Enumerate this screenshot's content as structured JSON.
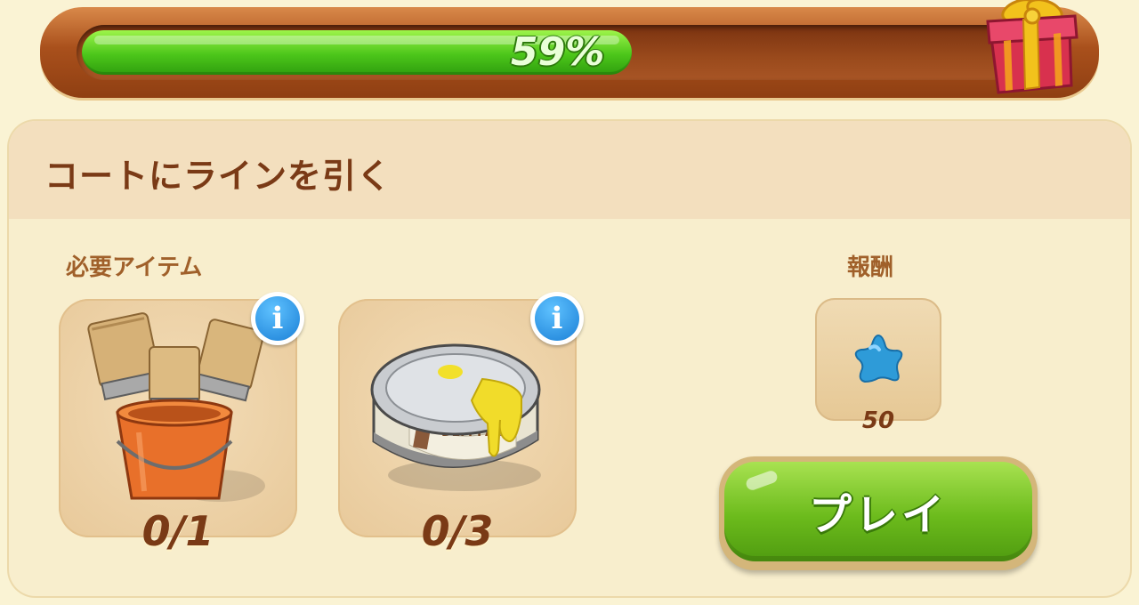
{
  "progress": {
    "percent": 59,
    "label": "59%"
  },
  "task": {
    "title": "コートにラインを引く"
  },
  "required": {
    "label": "必要アイテム",
    "items": [
      {
        "icon": "paint-brush-bucket-icon",
        "count": "0/1",
        "info_icon": "info-icon"
      },
      {
        "icon": "paint-can-icon",
        "count": "0/3",
        "info_icon": "info-icon"
      }
    ]
  },
  "reward": {
    "label": "報酬",
    "icon": "blue-star-icon",
    "amount": "50"
  },
  "play_button": {
    "label": "プレイ"
  },
  "colors": {
    "progress_green": "#4cc61a",
    "frame_brown": "#a9501c",
    "panel_bg": "#f8eecd",
    "title_brown": "#7a3a16",
    "info_blue": "#1a7fd6",
    "star_blue": "#2e9bd8",
    "play_green": "#6cbb1c"
  }
}
